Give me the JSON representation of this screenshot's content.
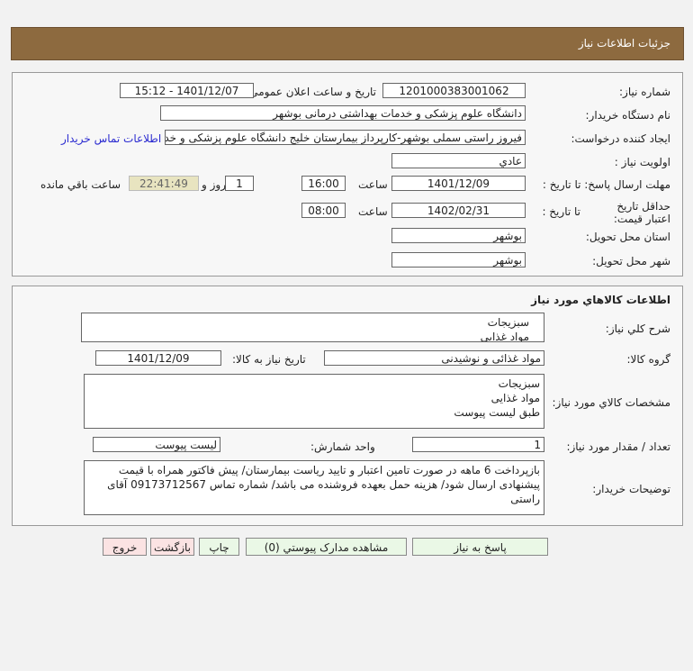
{
  "header": {
    "title": "جزئیات اطلاعات نیاز"
  },
  "info": {
    "need_number_label": "شماره نیاز:",
    "need_number": "1201000383001062",
    "announce_label": "تاریخ و ساعت اعلان عمومی:",
    "announce_value": "1401/12/07 - 15:12",
    "buyer_label": "نام دستگاه خریدار:",
    "buyer": "دانشگاه علوم پزشکی و خدمات بهداشتی درمانی بوشهر",
    "creator_label": "ایجاد کننده درخواست:",
    "creator": "فیروز راستی سملی بوشهر-کارپرداز بیمارستان خلیج دانشگاه علوم پزشکی و خد",
    "contact_link": "اطلاعات تماس خریدار",
    "priority_label": "اولویت نیاز :",
    "priority": "عادي",
    "deadline_label": "مهلت ارسال پاسخ: تا تاریخ :",
    "deadline_date": "1401/12/09",
    "time_label": "ساعت",
    "deadline_time": "16:00",
    "days": "1",
    "days_label": "روز و",
    "remaining": "22:41:49",
    "remaining_label": "ساعت باقي مانده",
    "validity_label": "حداقل تاریخ اعتبار قیمت:",
    "validity_to_label": "تا تاریخ :",
    "validity_date": "1402/02/31",
    "validity_time": "08:00",
    "province_label": "استان محل تحویل:",
    "province": "بوشهر",
    "city_label": "شهر محل تحویل:",
    "city": "بوشهر"
  },
  "goods": {
    "title": "اطلاعات کالاهاي مورد نياز",
    "desc_label": "شرح کلي نياز:",
    "desc_lines": [
      "سبزیجات",
      "مواد غذایی"
    ],
    "group_label": "گروه کالا:",
    "group": "مواد غذائی و نوشیدنی",
    "need_date_label": "تاریخ نیاز به کالا:",
    "need_date": "1401/12/09",
    "spec_label": "مشخصات کالاي مورد نياز:",
    "spec_lines": [
      "سبزیجات",
      "مواد غذایی",
      "طبق لیست پیوست"
    ],
    "qty_label": "تعداد / مقدار مورد نیاز:",
    "qty": "1",
    "unit_label": "واحد شمارش:",
    "unit": "لیست پیوست",
    "notes_label": "توضیحات خریدار:",
    "notes": "بازپرداخت 6 ماهه در صورت تامین اعتبار و تایید ریاست بیمارستان/ پیش فاکتور همراه با قیمت پیشنهادی ارسال شود/ هزینه حمل بعهده فروشنده می باشد/ شماره تماس 09173712567 آقای راستی"
  },
  "buttons": {
    "reply": "پاسخ به نیاز",
    "attachments": "مشاهده مدارک پیوستي (0)",
    "print": "چاپ",
    "back": "بازگشت",
    "exit": "خروج"
  }
}
